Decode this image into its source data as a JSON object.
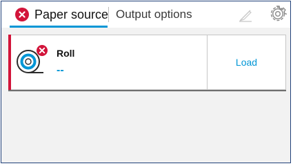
{
  "tabs": {
    "paper_source": {
      "label": "Paper source",
      "status_icon": "error-icon",
      "active": true
    },
    "output_options": {
      "label": "Output options",
      "active": false
    }
  },
  "toolbar": {
    "cut_icon": "cutter-icon",
    "settings_icon": "gear-icon"
  },
  "paper_sources": [
    {
      "name": "Roll",
      "value": "--",
      "icon": "roll-error-icon",
      "status_color": "#d2143a",
      "action_label": "Load"
    }
  ],
  "colors": {
    "accent": "#0096d6",
    "error": "#d2143a",
    "frame_border": "#1f3f78",
    "background": "#f2f2f2"
  }
}
